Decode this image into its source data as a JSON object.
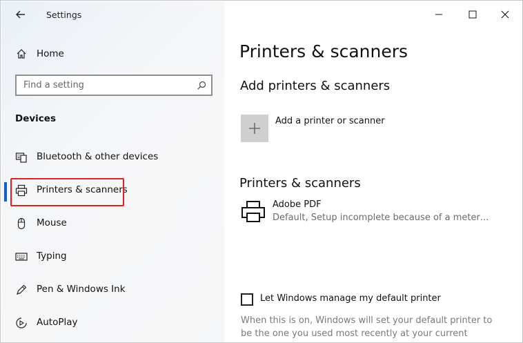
{
  "window": {
    "title": "Settings",
    "controls": {
      "minimize": "minimize-icon",
      "maximize": "maximize-icon",
      "close": "close-icon"
    }
  },
  "sidebar": {
    "home_label": "Home",
    "search_placeholder": "Find a setting",
    "section_title": "Devices",
    "items": [
      {
        "label": "Bluetooth & other devices",
        "icon": "bluetooth-keyboard-icon"
      },
      {
        "label": "Printers & scanners",
        "icon": "printer-icon",
        "selected": true
      },
      {
        "label": "Mouse",
        "icon": "mouse-icon"
      },
      {
        "label": "Typing",
        "icon": "keyboard-icon"
      },
      {
        "label": "Pen & Windows Ink",
        "icon": "pen-icon"
      },
      {
        "label": "AutoPlay",
        "icon": "autoplay-icon"
      }
    ],
    "accent_color": "#0a64c8",
    "highlight_color": "#e02020"
  },
  "main": {
    "title": "Printers & scanners",
    "add_section_title": "Add printers & scanners",
    "add_button_label": "Add a printer or scanner",
    "list_section_title": "Printers & scanners",
    "printers": [
      {
        "name": "Adobe PDF",
        "status": "Default, Setup incomplete because of a metered c..."
      }
    ],
    "default_printer_checkbox_label": "Let Windows manage my default printer",
    "default_printer_checked": false,
    "default_printer_help": "When this is on, Windows will set your default printer to be the one you used most recently at your current location."
  }
}
